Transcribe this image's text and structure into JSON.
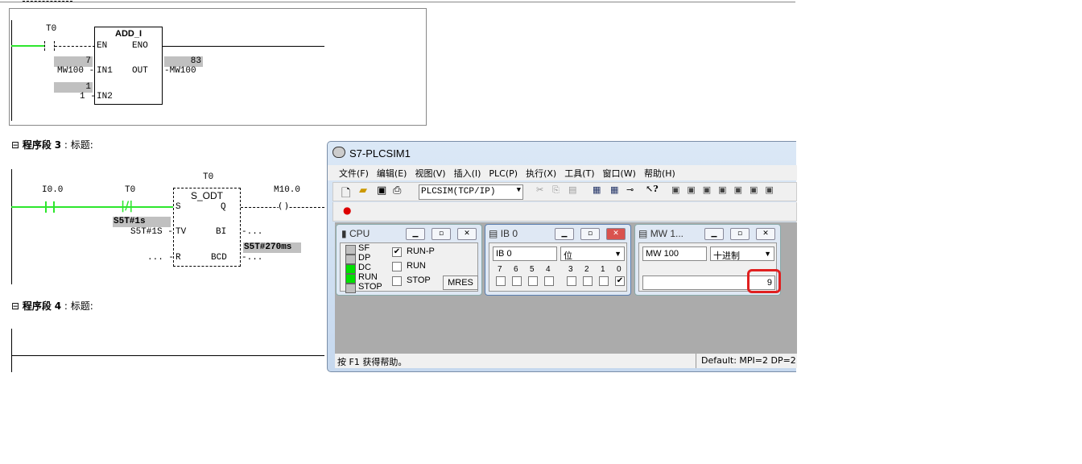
{
  "network2": {
    "contact_label": "T0",
    "block_name": "ADD_I",
    "pins": {
      "en": "EN",
      "eno": "ENO",
      "in1": "IN1",
      "out": "OUT",
      "in2": "IN2"
    },
    "in1_value": "7",
    "in1_operand": "MW100 -",
    "in2_value": "1",
    "in2_operand": "1 -",
    "out_value": "83",
    "out_operand": "-MW100"
  },
  "network3": {
    "header_toggle": "⊟",
    "header_label": "程序段",
    "number": "3",
    "title": "标题:",
    "contact1_label": "I0.0",
    "contact2_label": "T0",
    "timer_label": "T0",
    "block_name": "S_ODT",
    "pins": {
      "s": "S",
      "q": "Q",
      "tv": "TV",
      "bi": "BI",
      "r": "R",
      "bcd": "BCD"
    },
    "coil_label": "M10.0",
    "tv_value": "S5T#1s",
    "tv_operand": "S5T#1S -",
    "r_operand": "... -",
    "bi_operand": "-...",
    "bcd_operand": "-...",
    "bcd_value": "S5T#270ms"
  },
  "network4": {
    "header_toggle": "⊟",
    "header_label": "程序段",
    "number": "4",
    "title": "标题:"
  },
  "plcsim": {
    "title": "S7-PLCSIM1",
    "menu": [
      "文件(F)",
      "编辑(E)",
      "视图(V)",
      "插入(I)",
      "PLC(P)",
      "执行(X)",
      "工具(T)",
      "窗口(W)",
      "帮助(H)"
    ],
    "connection": "PLCSIM(TCP/IP)",
    "cpu": {
      "title": "CPU",
      "leds": [
        {
          "label": "SF",
          "color": "#c0c0c0"
        },
        {
          "label": "DP",
          "color": "#c0c0c0"
        },
        {
          "label": "DC",
          "color": "#00e000"
        },
        {
          "label": "RUN",
          "color": "#00e000"
        },
        {
          "label": "STOP",
          "color": "#c0c0c0"
        }
      ],
      "modes": [
        {
          "label": "RUN-P",
          "checked": true
        },
        {
          "label": "RUN",
          "checked": false
        },
        {
          "label": "STOP",
          "checked": false
        }
      ],
      "mres": "MRES"
    },
    "ib": {
      "title": "IB    0",
      "address": "IB     0",
      "format": "位",
      "bits": [
        {
          "label": "7",
          "checked": false
        },
        {
          "label": "6",
          "checked": false
        },
        {
          "label": "5",
          "checked": false
        },
        {
          "label": "4",
          "checked": false
        },
        {
          "label": "3",
          "checked": false
        },
        {
          "label": "2",
          "checked": false
        },
        {
          "label": "1",
          "checked": false
        },
        {
          "label": "0",
          "checked": true
        }
      ]
    },
    "mw": {
      "title": "MW    1...",
      "address": "MW   100",
      "format": "十进制",
      "value": "9",
      "highlight_color": "#e02020"
    },
    "status_left": "按 F1 获得帮助。",
    "status_right": "Default:  MPI=2 DP=2"
  }
}
